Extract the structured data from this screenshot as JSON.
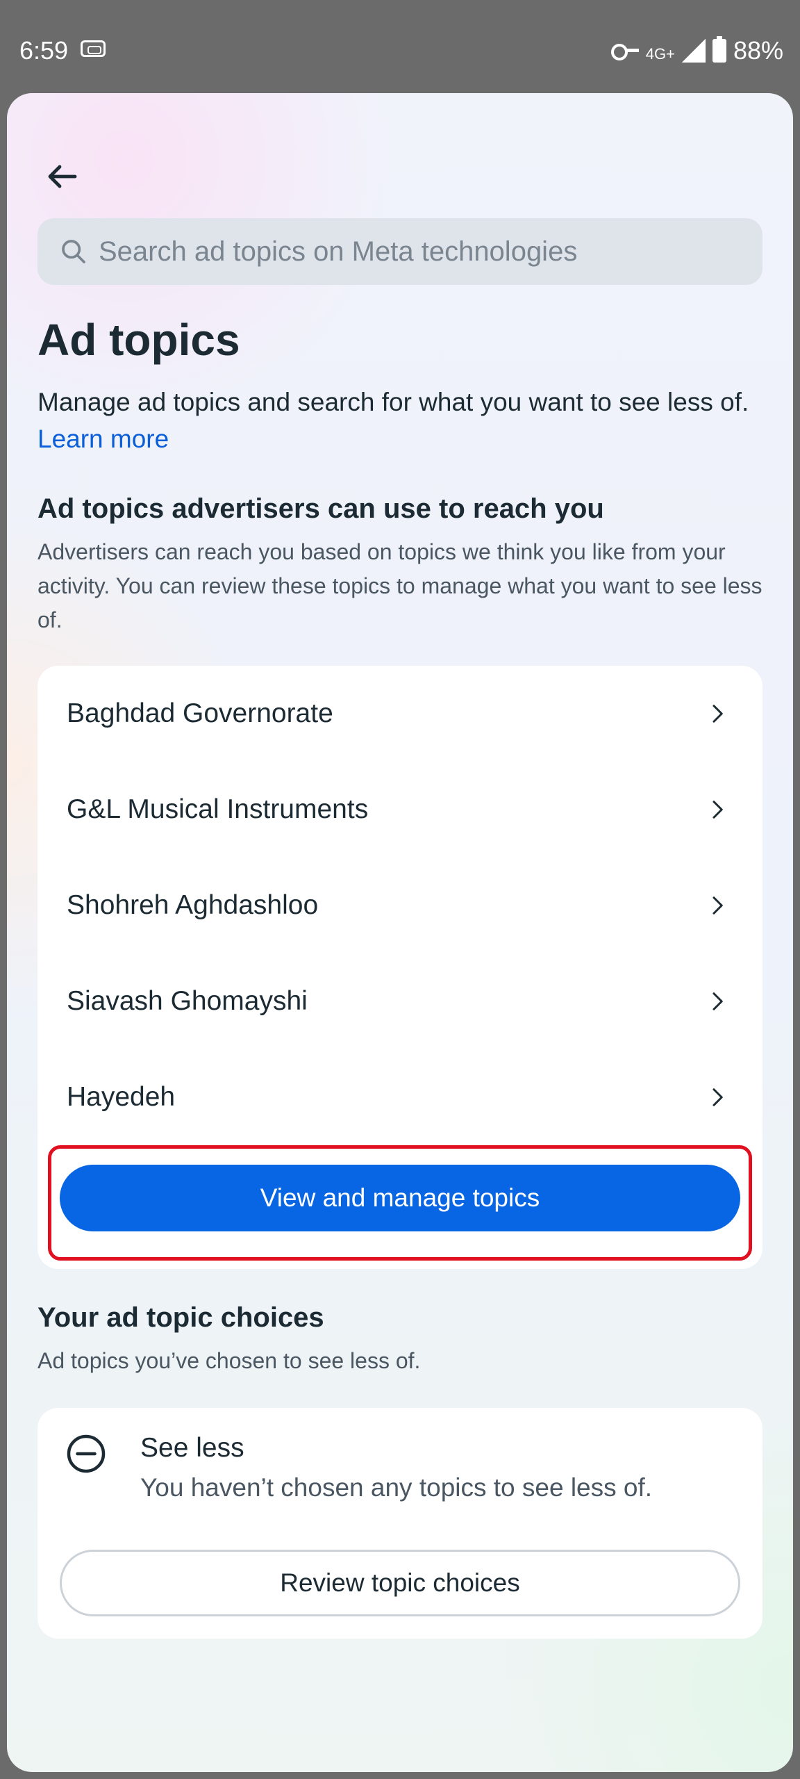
{
  "status_bar": {
    "time": "6:59",
    "network": "4G+",
    "battery": "88%"
  },
  "search": {
    "placeholder": "Search ad topics on Meta technologies"
  },
  "page": {
    "title": "Ad topics",
    "intro": "Manage ad topics and search for what you want to see less of.",
    "learn_more": "Learn more"
  },
  "advertisers_section": {
    "title": "Ad topics advertisers can use to reach you",
    "description": "Advertisers can reach you based on topics we think you like from your activity. You can review these topics to manage what you want to see less of.",
    "topics": [
      {
        "label": "Baghdad Governorate"
      },
      {
        "label": "G&L Musical Instruments"
      },
      {
        "label": "Shohreh Aghdashloo"
      },
      {
        "label": "Siavash Ghomayshi"
      },
      {
        "label": "Hayedeh"
      }
    ],
    "view_button": "View and manage topics"
  },
  "choices_section": {
    "title": "Your ad topic choices",
    "description": "Ad topics you’ve chosen to see less of.",
    "see_less_title": "See less",
    "see_less_subtitle": "You haven’t chosen any topics to see less of.",
    "review_button": "Review topic choices"
  },
  "colors": {
    "primary": "#0866e5",
    "link": "#0a5fd8",
    "highlight": "#e01020"
  }
}
